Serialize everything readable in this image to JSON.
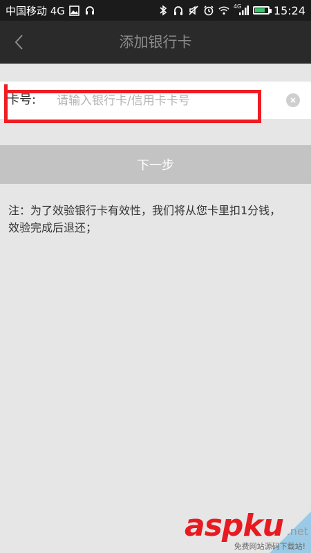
{
  "status_bar": {
    "carrier": "中国移动 4G",
    "left_icons": [
      "gallery-icon",
      "headset-icon"
    ],
    "right_icons": [
      "bluetooth-icon",
      "headphones-icon",
      "mute-icon",
      "alarm-icon",
      "wifi-icon",
      "signal-4g-icon",
      "battery-icon"
    ],
    "network_badge": "4G",
    "time": "15:24"
  },
  "nav": {
    "title": "添加银行卡",
    "back_icon": "chevron-left-icon"
  },
  "form": {
    "card_label": "卡号:",
    "card_placeholder": "请输入银行卡/信用卡卡号",
    "card_value": "",
    "clear_icon": "clear-icon",
    "next_label": "下一步"
  },
  "note": {
    "text": "注：为了效验银行卡有效性，我们将从您卡里扣1分钱，效验完成后退还；"
  },
  "watermark": {
    "logo": "aspku",
    "suffix": ".net",
    "subtitle": "免费网站源码下载站!"
  },
  "colors": {
    "status_bg": "#1b1b1b",
    "nav_bg": "#2a2a2a",
    "page_bg": "#e6e6e6",
    "next_button_bg": "#c3c3c3",
    "annotation_red": "#ee1c24",
    "battery_green": "#3cc56b"
  }
}
